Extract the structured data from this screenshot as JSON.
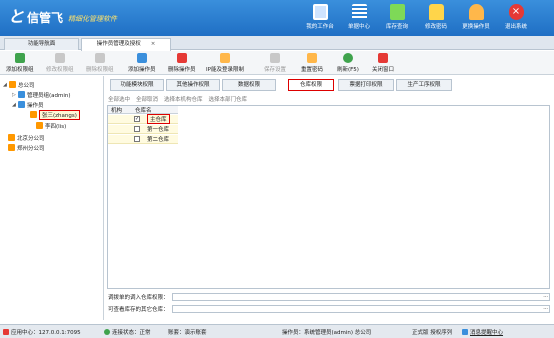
{
  "app": {
    "logo_mark": "と",
    "name": "信管飞",
    "slogan": "精细化管理软件"
  },
  "header_nav": [
    {
      "label": "我的工作台",
      "icon": "monitor-icon",
      "color": "#cfe4ff"
    },
    {
      "label": "单据中心",
      "icon": "list-icon",
      "color": "#ffffff"
    },
    {
      "label": "库存查询",
      "icon": "document-icon",
      "color": "#7ed957"
    },
    {
      "label": "修改密码",
      "icon": "lock-icon",
      "color": "#ffd54a"
    },
    {
      "label": "更换操作员",
      "icon": "user-icon",
      "color": "#ffb74a"
    },
    {
      "label": "退出系统",
      "icon": "close-icon",
      "color": "#e53935"
    }
  ],
  "tabs": [
    {
      "label": "功能导航面"
    },
    {
      "label": "操作员管理及授权",
      "close": "×"
    }
  ],
  "toolbar": {
    "add_group": "添加权限组",
    "edit_group": "修改权限组",
    "delete_group": "删除权限组",
    "add_operator": "添加操作员",
    "delete_operator": "删除操作员",
    "ip_login": "IP能及登录限制",
    "save_settings": "保存设置",
    "reset_password": "重置密码",
    "refresh": "刷新(F5)",
    "close_window": "关闭窗口"
  },
  "tree": {
    "root": "总公司",
    "admin_group": "管理员组(admin)",
    "operator": "操作员",
    "user1": "张三(zhangs)",
    "user2": "李四(lis)",
    "branch1": "北京分公司",
    "branch2": "郑州分公司"
  },
  "right_tabs": [
    "功能模块权限",
    "其他操作权限",
    "数据权限",
    "仓库权限",
    "票据打印权限",
    "生产工序权限"
  ],
  "subbar": [
    "全部选中",
    "全部取消",
    "选择本机构仓库",
    "选择本部门仓库"
  ],
  "grid": {
    "headers": [
      "机构",
      "仓库名"
    ],
    "rows": [
      {
        "checked": true,
        "label": "主仓库"
      },
      {
        "checked": false,
        "label": "第一仓库"
      },
      {
        "checked": false,
        "label": "第二仓库"
      }
    ]
  },
  "fields": {
    "default_in": "调拨单的调入仓库权限：",
    "view_other": "可查看库存的其它仓库："
  },
  "status": {
    "app_center": "应用中心：127.0.0.1:7095",
    "conn": "连接状态：正常",
    "account": "账套：演示账套",
    "operator": "操作员：系统管理员(admin) 总公司",
    "edition": "正式版 授权序列",
    "reminder": "消息提醒中心"
  },
  "colors": {
    "header": "#2a80d4",
    "selected_border": "#dd0000",
    "highlight_row": "#fffbe0"
  }
}
